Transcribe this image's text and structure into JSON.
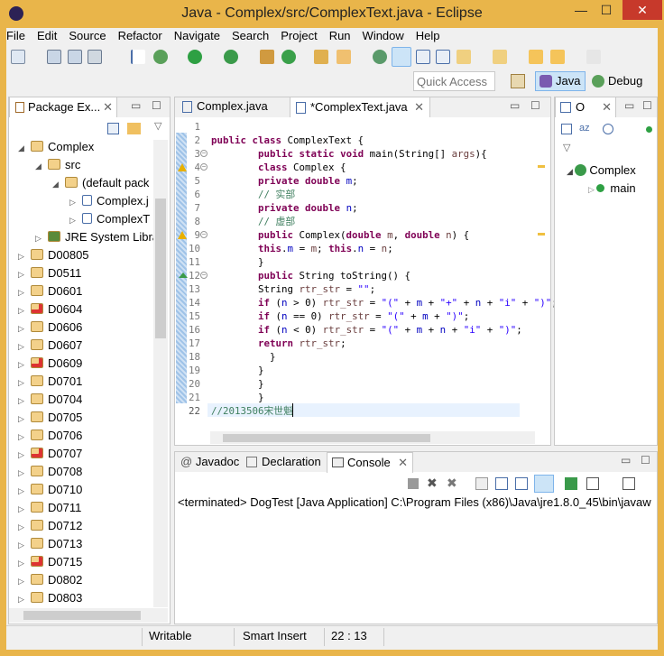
{
  "window": {
    "title": "Java - Complex/src/ComplexText.java - Eclipse",
    "minimize": "—",
    "maximize": "☐",
    "close": "✕"
  },
  "menu": [
    "File",
    "Edit",
    "Source",
    "Refactor",
    "Navigate",
    "Search",
    "Project",
    "Run",
    "Window",
    "Help"
  ],
  "quick_access": {
    "placeholder": "Quick Access"
  },
  "perspectives": {
    "java": "Java",
    "debug": "Debug"
  },
  "package_explorer": {
    "tab": "Package Ex...",
    "tree": [
      {
        "label": "Complex",
        "depth": 0,
        "expanded": true
      },
      {
        "label": "src",
        "depth": 1,
        "expanded": true
      },
      {
        "label": "(default pack",
        "depth": 2,
        "expanded": true
      },
      {
        "label": "Complex.j",
        "depth": 3
      },
      {
        "label": "ComplexT",
        "depth": 3
      },
      {
        "label": "JRE System Libra",
        "depth": 1
      },
      {
        "label": "D00805",
        "depth": 0
      },
      {
        "label": "D0511",
        "depth": 0
      },
      {
        "label": "D0601",
        "depth": 0
      },
      {
        "label": "D0604",
        "depth": 0
      },
      {
        "label": "D0606",
        "depth": 0
      },
      {
        "label": "D0607",
        "depth": 0
      },
      {
        "label": "D0609",
        "depth": 0
      },
      {
        "label": "D0701",
        "depth": 0
      },
      {
        "label": "D0704",
        "depth": 0
      },
      {
        "label": "D0705",
        "depth": 0
      },
      {
        "label": "D0706",
        "depth": 0
      },
      {
        "label": "D0707",
        "depth": 0
      },
      {
        "label": "D0708",
        "depth": 0
      },
      {
        "label": "D0710",
        "depth": 0
      },
      {
        "label": "D0711",
        "depth": 0
      },
      {
        "label": "D0712",
        "depth": 0
      },
      {
        "label": "D0713",
        "depth": 0
      },
      {
        "label": "D0715",
        "depth": 0
      },
      {
        "label": "D0802",
        "depth": 0
      },
      {
        "label": "D0803",
        "depth": 0
      }
    ]
  },
  "editor": {
    "tabs": [
      {
        "label": "Complex.java"
      },
      {
        "label": "*ComplexText.java",
        "active": true
      }
    ],
    "lines": [
      "",
      "<k>public</k> <k>class</k> ComplexText {",
      "        <k>public</k> <k>static</k> <k>void</k> main(String[] <v>args</v>){",
      "        <k>class</k> Complex {",
      "        <k>private</k> <k>double</k> <f>m</f>;",
      "        <c>// 实部</c>",
      "        <k>private</k> <k>double</k> <f>n</f>;",
      "        <c>// 虚部</c>",
      "        <k>public</k> Complex(<k>double</k> <v>m</v>, <k>double</k> <v>n</v>) {",
      "        <k>this</k>.<f>m</f> = <v>m</v>; <k>this</k>.<f>n</f> = <v>n</v>;",
      "        }",
      "        <k>public</k> String toString() {",
      "        String <v>rtr_str</v> = <s>\"\"</s>;",
      "        <k>if</k> (<f>n</f> > 0) <v>rtr_str</v> = <s>\"(\"</s> + <f>m</f> + <s>\"+\"</s> + <f>n</f> + <s>\"i\"</s> + <s>\")\"</s>;",
      "        <k>if</k> (<f>n</f> == 0) <v>rtr_str</v> = <s>\"(\"</s> + <f>m</f> + <s>\")\"</s>;",
      "        <k>if</k> (<f>n</f> < 0) <v>rtr_str</v> = <s>\"(\"</s> + <f>m</f> + <f>n</f> + <s>\"i\"</s> + <s>\")\"</s>;",
      "        <k>return</k> <v>rtr_str</v>;",
      "          }",
      "        }",
      "        }",
      "        }",
      "<c>//2013506宋世魁</c>"
    ]
  },
  "outline": {
    "tab": "O",
    "items": [
      "Complex",
      "main"
    ]
  },
  "bottom": {
    "tabs": [
      {
        "label": "Javadoc"
      },
      {
        "label": "Declaration"
      },
      {
        "label": "Console",
        "active": true
      }
    ],
    "console_header": "<terminated> DogTest [Java Application] C:\\Program Files (x86)\\Java\\jre1.8.0_45\\bin\\javaw"
  },
  "status": {
    "writable": "Writable",
    "insert_mode": "Smart Insert",
    "position": "22 : 13"
  }
}
